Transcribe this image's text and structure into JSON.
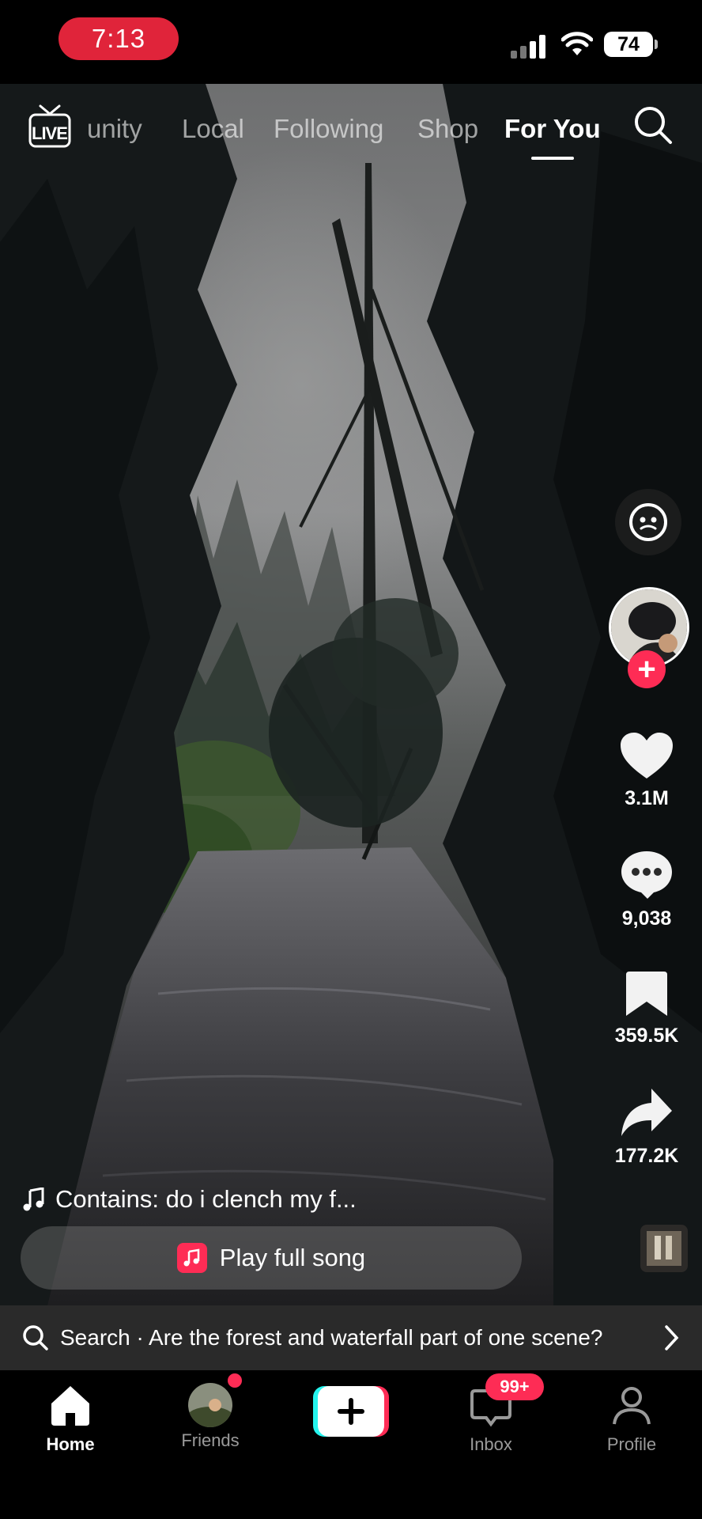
{
  "status_bar": {
    "time": "7:13",
    "battery": "74"
  },
  "top_nav": {
    "live_label": "LIVE",
    "tabs": [
      {
        "label": "unity"
      },
      {
        "label": "Local"
      },
      {
        "label": "Following"
      },
      {
        "label": "Shop"
      },
      {
        "label": "For You"
      }
    ],
    "active_tab": "For You"
  },
  "actions": {
    "likes": "3.1M",
    "comments": "9,038",
    "saves": "359.5K",
    "shares": "177.2K"
  },
  "song": {
    "contains_text": "Contains: do i clench my f...",
    "play_button_label": "Play full song"
  },
  "search_bar": {
    "text": "Search · Are the forest and waterfall part of one scene?"
  },
  "bottom_nav": {
    "items": [
      {
        "label": "Home",
        "icon": "home-icon"
      },
      {
        "label": "Friends",
        "icon": "friends-avatar"
      },
      {
        "label": "",
        "icon": "create-plus-icon"
      },
      {
        "label": "Inbox",
        "icon": "inbox-icon"
      },
      {
        "label": "Profile",
        "icon": "profile-icon"
      }
    ],
    "inbox_badge": "99+"
  },
  "colors": {
    "accent_red": "#fe2c55",
    "time_pill": "#e0243a",
    "search_bar_bg": "#2a2a2a"
  }
}
